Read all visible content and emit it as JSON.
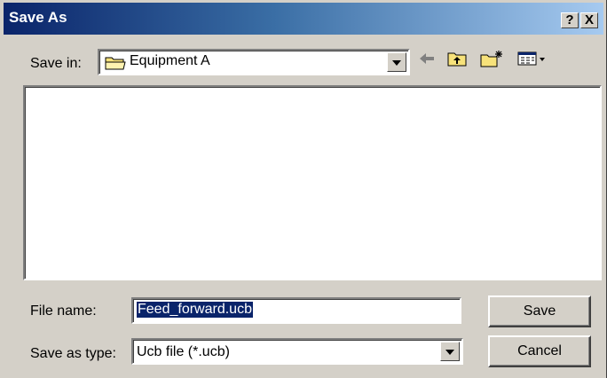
{
  "window": {
    "title": "Save As",
    "help_btn": "?",
    "close_btn": "X"
  },
  "save_in": {
    "label": "Save in:",
    "value": "Equipment A"
  },
  "icons": {
    "folder": "folder-icon",
    "back": "back-arrow-icon",
    "up": "up-folder-icon",
    "new_folder": "new-folder-icon",
    "view_menu": "view-menu-icon"
  },
  "file_name": {
    "label": "File name:",
    "value": "Feed_forward.ucb"
  },
  "save_as_type": {
    "label": "Save as type:",
    "value": "Ucb file (*.ucb)"
  },
  "buttons": {
    "save": "Save",
    "cancel": "Cancel"
  },
  "colors": {
    "title_start": "#0a246a",
    "title_end": "#a6caf0",
    "dialog_bg": "#d4d0c8",
    "selection": "#0a246a"
  }
}
